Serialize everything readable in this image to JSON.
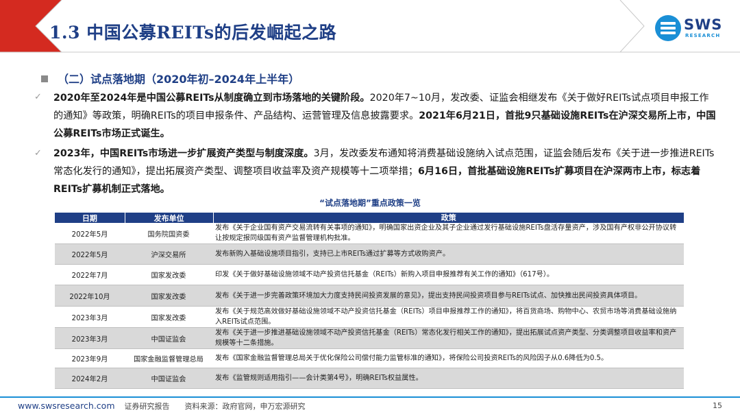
{
  "header": {
    "title": "1.3 中国公募REITs的后发崛起之路",
    "logo_text": "SWS",
    "logo_sub": "RESEARCH"
  },
  "section": {
    "title": "（二）试点落地期（2020年初–2024年上半年）"
  },
  "paragraphs": [
    {
      "bold1": "2020年至2024年是中国公募REITs从制度确立到市场落地的关键阶段。",
      "text1": "2020年7~10月，发改委、证监会相继发布《关于做好REITs试点项目申报工作的通知》等政策，明确REITs的项目申报条件、产品结构、运营管理及信息披露要求。",
      "bold2": "2021年6月21日，首批9只基础设施REITs在沪深交易所上市，中国公募REITs市场正式诞生。"
    },
    {
      "bold1": "2023年，中国REITs市场进一步扩展资产类型与制度深度。",
      "text1": "3月，发改委发布通知将消费基础设施纳入试点范围，证监会随后发布《关于进一步推进REITs常态化发行的通知》，提出拓展资产类型、调整项目收益率及资产规模等十二项举措；",
      "bold2": "6月16日，首批基础设施REITs扩募项目在沪深两市上市，标志着REITs扩募机制正式落地。"
    }
  ],
  "table": {
    "title": "“试点落地期”重点政策一览",
    "headers": [
      "日期",
      "发布单位",
      "政策"
    ],
    "rows": [
      {
        "date": "2022年5月",
        "org": "国务院国资委",
        "policy": "发布《关于企业国有资产交易流转有关事项的通知》，明确国家出资企业及其子企业通过发行基础设施REITs盘活存量资产，涉及国有产权非公开协议转让按规定报同级国有资产监督管理机构批准。"
      },
      {
        "date": "2022年5月",
        "org": "沪深交易所",
        "policy": "发布新购入基础设施项目指引，支持已上市REITs通过扩募等方式收购资产。"
      },
      {
        "date": "2022年7月",
        "org": "国家发改委",
        "policy": "印发《关于做好基础设施领域不动产投资信托基金（REITs）新购入项目申报推荐有关工作的通知》（617号）。"
      },
      {
        "date": "2022年10月",
        "org": "国家发改委",
        "policy": "发布《关于进一步完善政策环境加大力度支持民间投资发展的意见》，提出支持民间投资项目参与REITs试点、加快推出民间投资具体项目。"
      },
      {
        "date": "2023年3月",
        "org": "国家发改委",
        "policy": "发布《关于规范高效做好基础设施领域不动产投资信托基金（REITs）项目申报推荐工作的通知》，将百货商场、购物中心、农贸市场等消费基础设施纳入REITs试点范围。"
      },
      {
        "date": "2023年3月",
        "org": "中国证监会",
        "policy": "发布《关于进一步推进基础设施领域不动产投资信托基金（REITs）常态化发行相关工作的通知》，提出拓展试点资产类型、分类调整项目收益率和资产规模等十二条措施。"
      },
      {
        "date": "2023年9月",
        "org": "国家金融监督管理总局",
        "policy": "发布《国家金融监督管理总局关于优化保险公司偿付能力监管标准的通知》，将保险公司投资REITs的风险因子从0.6降低为0.5。"
      },
      {
        "date": "2024年2月",
        "org": "中国证监会",
        "policy": "发布《监管规则适用指引——会计类第4号》，明确REITs权益属性。"
      }
    ]
  },
  "footer": {
    "url": "www.swsresearch.com",
    "label": "证券研究报告",
    "source": "资料来源：政府官网，申万宏源研究",
    "page": "15"
  },
  "colors": {
    "navy": "#1f3f86",
    "accent_blue": "#1a8fd6",
    "header_red": "#d42a20",
    "row_grey": "#d9d9d9"
  }
}
